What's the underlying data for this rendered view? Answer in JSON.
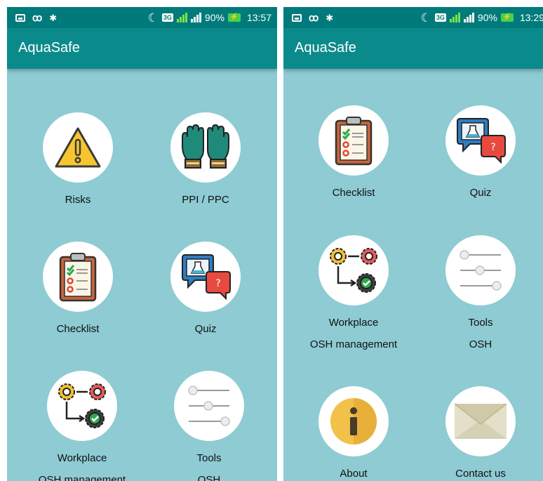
{
  "screens": [
    {
      "status": {
        "battery": "90%",
        "time": "13:57",
        "network": "3G"
      },
      "app_title": "AquaSafe",
      "tiles": [
        {
          "label": "Risks",
          "icon": "warning-icon"
        },
        {
          "label": "PPI / PPC",
          "icon": "gloves-icon"
        },
        {
          "label": "Checklist",
          "icon": "clipboard-checklist-icon"
        },
        {
          "label": "Quiz",
          "icon": "quiz-chat-icon"
        },
        {
          "label": "Workplace",
          "sublabel": "OSH management",
          "icon": "gears-workflow-icon"
        },
        {
          "label": "Tools",
          "sublabel": "OSH",
          "icon": "sliders-icon"
        }
      ]
    },
    {
      "status": {
        "battery": "90%",
        "time": "13:29",
        "network": "3G"
      },
      "app_title": "AquaSafe",
      "tiles": [
        {
          "label": "Checklist",
          "icon": "clipboard-checklist-icon"
        },
        {
          "label": "Quiz",
          "icon": "quiz-chat-icon"
        },
        {
          "label": "Workplace",
          "sublabel": "OSH management",
          "icon": "gears-workflow-icon"
        },
        {
          "label": "Tools",
          "sublabel": "OSH",
          "icon": "sliders-icon"
        },
        {
          "label": "About",
          "icon": "info-icon"
        },
        {
          "label": "Contact us",
          "icon": "envelope-icon"
        }
      ]
    }
  ]
}
